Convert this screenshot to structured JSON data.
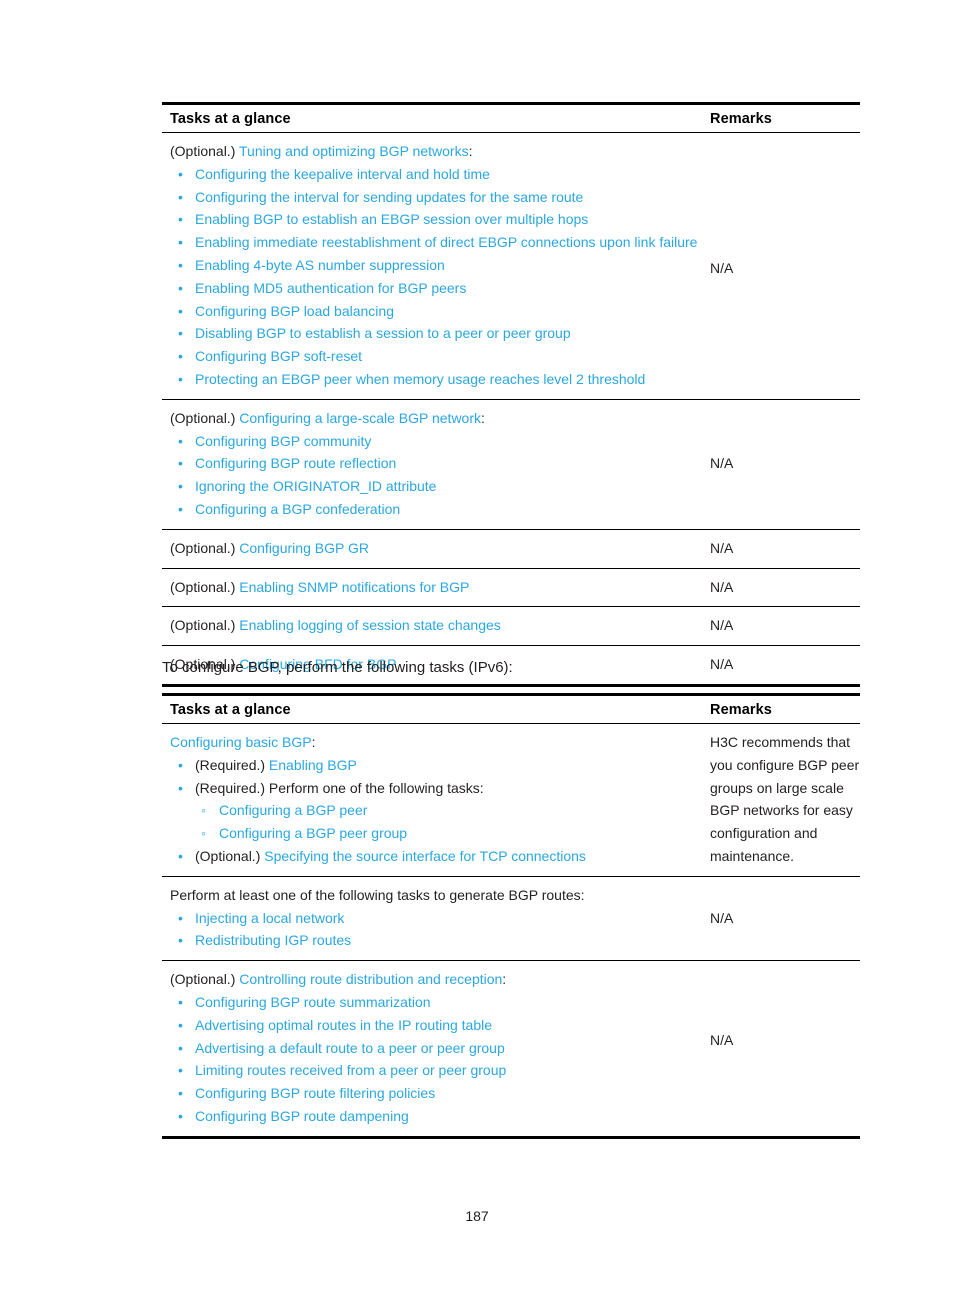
{
  "page": {
    "number": "187",
    "link_color": "#2ba7e0",
    "text_color": "#231f20"
  },
  "table_ipv4": {
    "headers": {
      "tasks": "Tasks at a glance",
      "remarks": "Remarks"
    },
    "rows": [
      {
        "lead_plain": "(Optional.) ",
        "lead_link": "Tuning and optimizing BGP networks",
        "lead_tail": ":",
        "bullets": [
          "Configuring the keepalive interval and hold time",
          "Configuring the interval for sending updates for the same route",
          "Enabling BGP to establish an EBGP session over multiple hops",
          "Enabling immediate reestablishment of direct EBGP connections upon link failure",
          "Enabling 4-byte AS number suppression",
          "Enabling MD5 authentication for BGP peers",
          "Configuring BGP load balancing",
          "Disabling BGP to establish a session to a peer or peer group",
          "Configuring BGP soft-reset",
          "Protecting an EBGP peer when memory usage reaches level 2 threshold"
        ],
        "remarks": "N/A"
      },
      {
        "lead_plain": "(Optional.) ",
        "lead_link": "Configuring a large-scale BGP network",
        "lead_tail": ":",
        "bullets": [
          "Configuring BGP community",
          "Configuring BGP route reflection",
          "Ignoring the ORIGINATOR_ID attribute",
          "Configuring a BGP confederation"
        ],
        "remarks": "N/A"
      },
      {
        "lead_plain": "(Optional.) ",
        "lead_link": "Configuring BGP GR",
        "lead_tail": "",
        "bullets": [],
        "remarks": "N/A"
      },
      {
        "lead_plain": "(Optional.) ",
        "lead_link": "Enabling SNMP notifications for BGP",
        "lead_tail": "",
        "bullets": [],
        "remarks": "N/A"
      },
      {
        "lead_plain": "(Optional.) ",
        "lead_link": "Enabling logging of session state changes",
        "lead_tail": "",
        "bullets": [],
        "remarks": "N/A"
      },
      {
        "lead_plain": "(Optional.) ",
        "lead_link": "Configuring BFD for BGP",
        "lead_tail": "",
        "bullets": [],
        "remarks": "N/A"
      }
    ]
  },
  "interstitial": "To configure BGP, perform the following tasks (IPv6):",
  "table_ipv6": {
    "headers": {
      "tasks": "Tasks at a glance",
      "remarks": "Remarks"
    },
    "row_basic": {
      "lead_link": "Configuring basic BGP",
      "lead_tail": ":",
      "b1_plain": "(Required.) ",
      "b1_link": "Enabling BGP",
      "b2_plain": "(Required.) Perform one of the following tasks:",
      "sub": [
        "Configuring a BGP peer",
        "Configuring a BGP peer group"
      ],
      "b3_plain": "(Optional.) ",
      "b3_link": "Specifying the source interface for TCP connections",
      "remarks": "H3C recommends that you configure BGP peer groups on large scale BGP networks for easy configuration and maintenance."
    },
    "row_generate": {
      "lead_plain": "Perform at least one of the following tasks to generate BGP routes:",
      "bullets": [
        "Injecting a local network",
        "Redistributing IGP routes"
      ],
      "remarks": "N/A"
    },
    "row_control": {
      "lead_plain": "(Optional.) ",
      "lead_link": "Controlling route distribution and reception",
      "lead_tail": ":",
      "bullets": [
        "Configuring BGP route summarization",
        "Advertising optimal routes in the IP routing table",
        "Advertising a default route to a peer or peer group",
        "Limiting routes received from a peer or peer group",
        "Configuring BGP route filtering policies",
        "Configuring BGP route dampening"
      ],
      "remarks": "N/A"
    }
  }
}
